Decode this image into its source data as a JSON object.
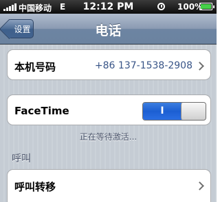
{
  "status_bar": {
    "carrier": "中国移动",
    "network": "E",
    "time": "12:12 PM",
    "battery": "100%",
    "icons": [
      "signal-icon",
      "rotation-lock-icon",
      "battery-icon"
    ]
  },
  "nav": {
    "back_label": "设置",
    "title": "电话"
  },
  "my_number": {
    "label": "本机号码",
    "value": "+86 137-1538-2908"
  },
  "facetime": {
    "label": "FaceTime",
    "toggle_label": "I",
    "enabled": true,
    "status": "正在等待激活..."
  },
  "calls_section": {
    "header": "呼叫",
    "items": [
      {
        "label": "呼叫转移"
      }
    ]
  },
  "colors": {
    "nav_bar": "#6d84a2",
    "toggle_on": "#1c5fd2",
    "value_text": "#385487",
    "background": "#c5ccd4"
  }
}
